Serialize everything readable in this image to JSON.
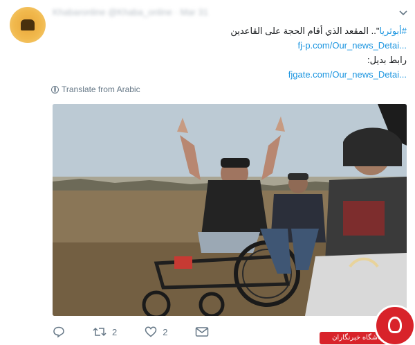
{
  "header": {
    "author_line_blurred": "Khabaronline @Khaba_online · Mar 31"
  },
  "tweet": {
    "line1_hashtag": "#أبوثريا",
    "line1_text": "\".. المقعد الذي أقام الحجة على القاعدين",
    "link1": "fj-p.com/Our_news_Detai...",
    "line3": "رابط بديل:",
    "link2": "fjgate.com/Our_news_Detai..."
  },
  "translate": {
    "label": "Translate from Arabic",
    "icon": "globe-icon"
  },
  "actions": {
    "reply_icon": "reply-icon",
    "retweet_icon": "retweet-icon",
    "retweet_count": "2",
    "like_icon": "heart-icon",
    "like_count": "2",
    "dm_icon": "envelope-icon"
  },
  "watermark": {
    "text": "باشگاه خبرنگاران",
    "color": "#d8232a"
  },
  "colors": {
    "link": "#1b95e0",
    "muted": "#657786"
  }
}
